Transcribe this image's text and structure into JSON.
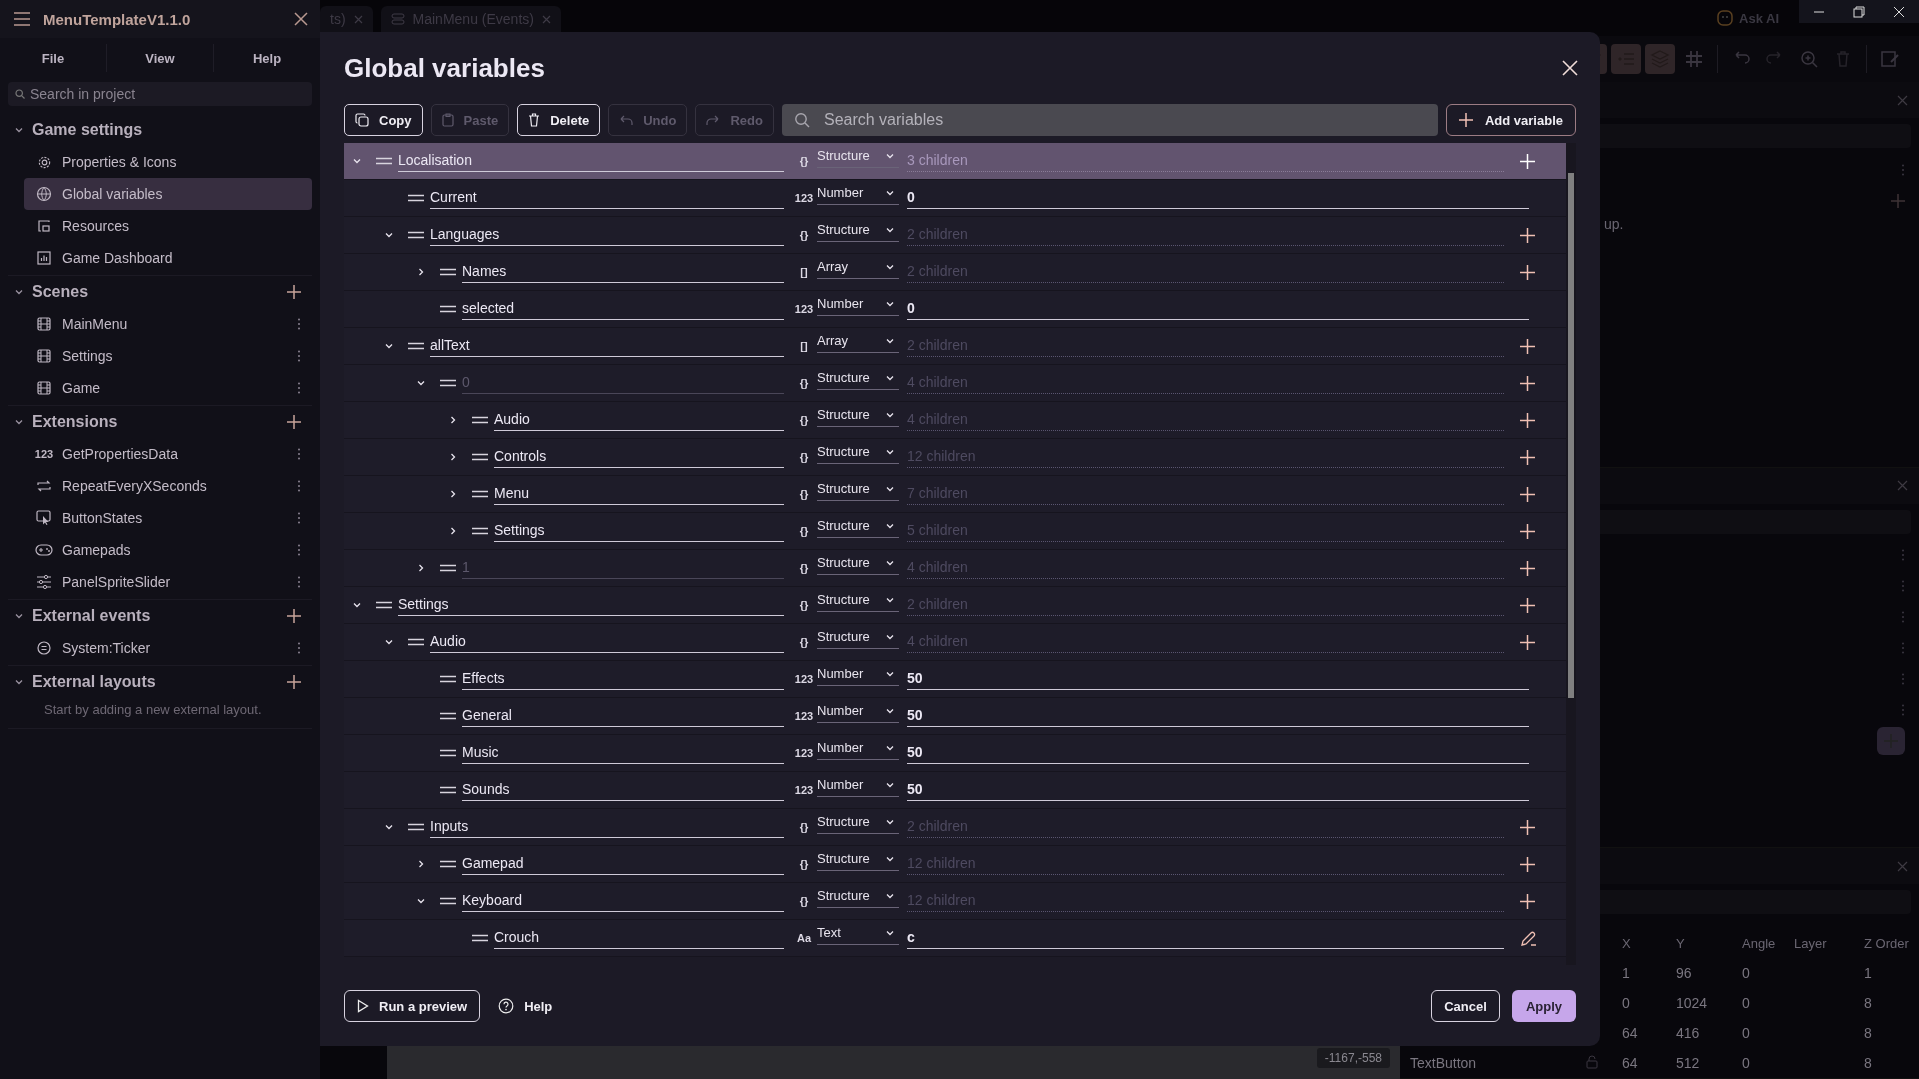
{
  "sidebar": {
    "app_title": "MenuTemplateV1.1.0",
    "menu": [
      "File",
      "View",
      "Help"
    ],
    "search": {
      "placeholder": "Search in project"
    },
    "sections": [
      {
        "title": "Game settings",
        "expanded": true,
        "addable": false,
        "item_menus": false,
        "items": [
          {
            "label": "Properties & Icons",
            "kind": "gear",
            "selected": false
          },
          {
            "label": "Global variables",
            "kind": "globe",
            "selected": true
          },
          {
            "label": "Resources",
            "kind": "resources",
            "selected": false
          },
          {
            "label": "Game Dashboard",
            "kind": "chart",
            "selected": false
          }
        ]
      },
      {
        "title": "Scenes",
        "expanded": true,
        "addable": true,
        "item_menus": true,
        "items": [
          {
            "label": "MainMenu",
            "kind": "film",
            "selected": false
          },
          {
            "label": "Settings",
            "kind": "film",
            "selected": false
          },
          {
            "label": "Game",
            "kind": "film",
            "selected": false
          }
        ]
      },
      {
        "title": "Extensions",
        "expanded": true,
        "addable": true,
        "item_menus": true,
        "items": [
          {
            "label": "GetPropertiesData",
            "kind": "glyph",
            "glyph": "123",
            "selected": false
          },
          {
            "label": "RepeatEveryXSeconds",
            "kind": "repeat",
            "selected": false
          },
          {
            "label": "ButtonStates",
            "kind": "pointer",
            "selected": false
          },
          {
            "label": "Gamepads",
            "kind": "gamepad",
            "selected": false
          },
          {
            "label": "PanelSpriteSlider",
            "kind": "sliders",
            "selected": false
          }
        ]
      },
      {
        "title": "External events",
        "expanded": true,
        "addable": true,
        "item_menus": true,
        "items": [
          {
            "label": "System:Ticker",
            "kind": "circle",
            "selected": false
          }
        ]
      },
      {
        "title": "External layouts",
        "expanded": true,
        "addable": true,
        "empty_hint": "Start by adding a new external layout."
      }
    ]
  },
  "background": {
    "tabs": [
      "ts)",
      "MainMenu (Events)"
    ],
    "ask_ai": "Ask AI",
    "hint_fragment": "up.",
    "instances": {
      "columns": [
        "X",
        "Y",
        "Angle",
        "Layer",
        "Z Order"
      ],
      "rows": [
        {
          "cells": [
            "1",
            "96",
            "0",
            "",
            "1"
          ]
        },
        {
          "cells": [
            "0",
            "1024",
            "0",
            "",
            "8"
          ]
        },
        {
          "cells": [
            "64",
            "416",
            "0",
            "",
            "8"
          ]
        },
        {
          "name": "TextButton",
          "cells": [
            "64",
            "512",
            "0",
            "",
            "8"
          ]
        }
      ]
    },
    "position_badge": "-1167,-558"
  },
  "dialog": {
    "title": "Global variables",
    "toolbar": [
      {
        "label": "Copy",
        "kind": "copy",
        "disabled": false
      },
      {
        "label": "Paste",
        "kind": "paste",
        "disabled": true
      },
      {
        "label": "Delete",
        "kind": "delete",
        "disabled": false
      },
      {
        "label": "Undo",
        "kind": "undo",
        "disabled": true
      },
      {
        "label": "Redo",
        "kind": "redo",
        "disabled": true
      }
    ],
    "search": {
      "placeholder": "Search variables"
    },
    "add_button": "Add variable",
    "variables": [
      {
        "name": "Localisation",
        "is_index": false,
        "kind": "structure",
        "type_icon": "{}",
        "type": "Structure",
        "children_label": "3 children",
        "expanded": true,
        "selected": true,
        "children": [
          {
            "name": "Current",
            "is_index": false,
            "kind": "number",
            "type_icon": "123",
            "type": "Number",
            "value": "0",
            "selected": false
          },
          {
            "name": "Languages",
            "is_index": false,
            "kind": "structure",
            "type_icon": "{}",
            "type": "Structure",
            "children_label": "2 children",
            "expanded": true,
            "selected": false,
            "children": [
              {
                "name": "Names",
                "is_index": false,
                "kind": "array",
                "type_icon": "[]",
                "type": "Array",
                "children_label": "2 children",
                "expanded": false,
                "selected": false
              },
              {
                "name": "selected",
                "is_index": false,
                "kind": "number",
                "type_icon": "123",
                "type": "Number",
                "value": "0",
                "selected": false
              }
            ]
          },
          {
            "name": "allText",
            "is_index": false,
            "kind": "array",
            "type_icon": "[]",
            "type": "Array",
            "children_label": "2 children",
            "expanded": true,
            "selected": false,
            "children": [
              {
                "name": "0",
                "is_index": true,
                "kind": "structure",
                "type_icon": "{}",
                "type": "Structure",
                "children_label": "4 children",
                "expanded": true,
                "selected": false,
                "children": [
                  {
                    "name": "Audio",
                    "is_index": false,
                    "kind": "structure",
                    "type_icon": "{}",
                    "type": "Structure",
                    "children_label": "4 children",
                    "expanded": false,
                    "selected": false
                  },
                  {
                    "name": "Controls",
                    "is_index": false,
                    "kind": "structure",
                    "type_icon": "{}",
                    "type": "Structure",
                    "children_label": "12 children",
                    "expanded": false,
                    "selected": false
                  },
                  {
                    "name": "Menu",
                    "is_index": false,
                    "kind": "structure",
                    "type_icon": "{}",
                    "type": "Structure",
                    "children_label": "7 children",
                    "expanded": false,
                    "selected": false
                  },
                  {
                    "name": "Settings",
                    "is_index": false,
                    "kind": "structure",
                    "type_icon": "{}",
                    "type": "Structure",
                    "children_label": "5 children",
                    "expanded": false,
                    "selected": false
                  }
                ]
              },
              {
                "name": "1",
                "is_index": true,
                "kind": "structure",
                "type_icon": "{}",
                "type": "Structure",
                "children_label": "4 children",
                "expanded": false,
                "selected": false
              }
            ]
          }
        ]
      },
      {
        "name": "Settings",
        "is_index": false,
        "kind": "structure",
        "type_icon": "{}",
        "type": "Structure",
        "children_label": "2 children",
        "expanded": true,
        "selected": false,
        "children": [
          {
            "name": "Audio",
            "is_index": false,
            "kind": "structure",
            "type_icon": "{}",
            "type": "Structure",
            "children_label": "4 children",
            "expanded": true,
            "selected": false,
            "children": [
              {
                "name": "Effects",
                "is_index": false,
                "kind": "number",
                "type_icon": "123",
                "type": "Number",
                "value": "50",
                "selected": false
              },
              {
                "name": "General",
                "is_index": false,
                "kind": "number",
                "type_icon": "123",
                "type": "Number",
                "value": "50",
                "selected": false
              },
              {
                "name": "Music",
                "is_index": false,
                "kind": "number",
                "type_icon": "123",
                "type": "Number",
                "value": "50",
                "selected": false
              },
              {
                "name": "Sounds",
                "is_index": false,
                "kind": "number",
                "type_icon": "123",
                "type": "Number",
                "value": "50",
                "selected": false
              }
            ]
          },
          {
            "name": "Inputs",
            "is_index": false,
            "kind": "structure",
            "type_icon": "{}",
            "type": "Structure",
            "children_label": "2 children",
            "expanded": true,
            "selected": false,
            "children": [
              {
                "name": "Gamepad",
                "is_index": false,
                "kind": "structure",
                "type_icon": "{}",
                "type": "Structure",
                "children_label": "12 children",
                "expanded": false,
                "selected": false
              },
              {
                "name": "Keyboard",
                "is_index": false,
                "kind": "structure",
                "type_icon": "{}",
                "type": "Structure",
                "children_label": "12 children",
                "expanded": true,
                "selected": false,
                "children": [
                  {
                    "name": "Crouch",
                    "is_index": false,
                    "kind": "text",
                    "type_icon": "Aa",
                    "type": "Text",
                    "value": "c",
                    "selected": false
                  }
                ]
              }
            ]
          }
        ]
      }
    ],
    "footer": {
      "preview": "Run a preview",
      "help": "Help",
      "cancel": "Cancel",
      "apply": "Apply"
    }
  }
}
